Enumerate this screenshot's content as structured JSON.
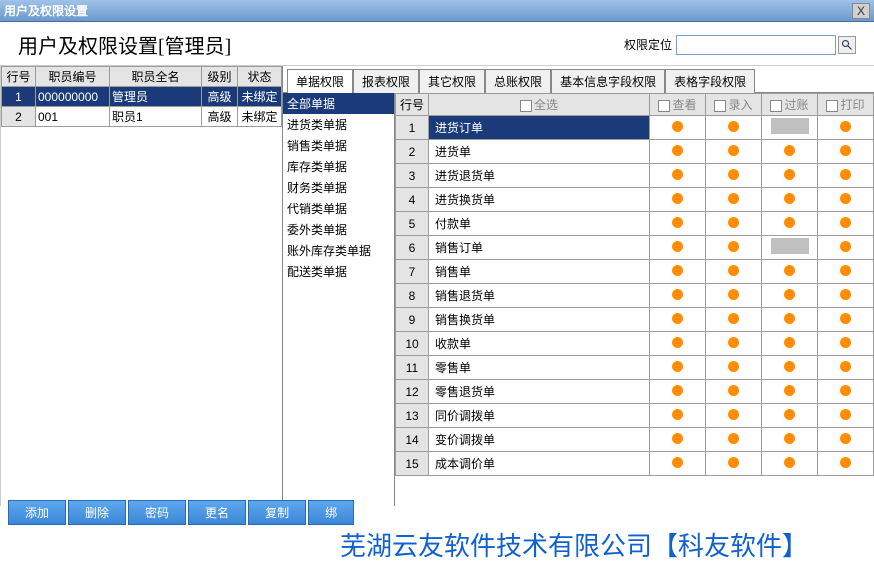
{
  "window": {
    "title": "用户及权限设置",
    "close": "X"
  },
  "header": {
    "title": "用户及权限设置[管理员]",
    "search_label": "权限定位",
    "search_value": ""
  },
  "employee_table": {
    "cols": {
      "row": "行号",
      "id": "职员编号",
      "name": "职员全名",
      "level": "级别",
      "status": "状态"
    },
    "rows": [
      {
        "n": "1",
        "id": "000000000",
        "name": "管理员",
        "level": "高级",
        "status": "未绑定",
        "selected": true
      },
      {
        "n": "2",
        "id": "001",
        "name": "职员1",
        "level": "高级",
        "status": "未绑定",
        "selected": false
      }
    ]
  },
  "tabs": [
    "单据权限",
    "报表权限",
    "其它权限",
    "总账权限",
    "基本信息字段权限",
    "表格字段权限"
  ],
  "active_tab": 0,
  "categories": [
    {
      "label": "全部单据",
      "selected": true
    },
    {
      "label": "进货类单据"
    },
    {
      "label": "销售类单据"
    },
    {
      "label": "库存类单据"
    },
    {
      "label": "财务类单据"
    },
    {
      "label": "代销类单据"
    },
    {
      "label": "委外类单据"
    },
    {
      "label": "账外库存类单据"
    },
    {
      "label": "配送类单据"
    }
  ],
  "perm_cols": {
    "row": "行号",
    "all": "全选",
    "view": "查看",
    "entry": "录入",
    "post": "过账",
    "print": "打印"
  },
  "perm_rows": [
    {
      "n": "1",
      "name": "进货订单",
      "v": "d",
      "e": "d",
      "p": "g",
      "pr": "d",
      "selected": true
    },
    {
      "n": "2",
      "name": "进货单",
      "v": "d",
      "e": "d",
      "p": "d",
      "pr": "d"
    },
    {
      "n": "3",
      "name": "进货退货单",
      "v": "d",
      "e": "d",
      "p": "d",
      "pr": "d"
    },
    {
      "n": "4",
      "name": "进货换货单",
      "v": "d",
      "e": "d",
      "p": "d",
      "pr": "d"
    },
    {
      "n": "5",
      "name": "付款单",
      "v": "d",
      "e": "d",
      "p": "d",
      "pr": "d"
    },
    {
      "n": "6",
      "name": "销售订单",
      "v": "d",
      "e": "d",
      "p": "g",
      "pr": "d"
    },
    {
      "n": "7",
      "name": "销售单",
      "v": "d",
      "e": "d",
      "p": "d",
      "pr": "d"
    },
    {
      "n": "8",
      "name": "销售退货单",
      "v": "d",
      "e": "d",
      "p": "d",
      "pr": "d"
    },
    {
      "n": "9",
      "name": "销售换货单",
      "v": "d",
      "e": "d",
      "p": "d",
      "pr": "d"
    },
    {
      "n": "10",
      "name": "收款单",
      "v": "d",
      "e": "d",
      "p": "d",
      "pr": "d"
    },
    {
      "n": "11",
      "name": "零售单",
      "v": "d",
      "e": "d",
      "p": "d",
      "pr": "d"
    },
    {
      "n": "12",
      "name": "零售退货单",
      "v": "d",
      "e": "d",
      "p": "d",
      "pr": "d"
    },
    {
      "n": "13",
      "name": "同价调拨单",
      "v": "d",
      "e": "d",
      "p": "d",
      "pr": "d"
    },
    {
      "n": "14",
      "name": "变价调拨单",
      "v": "d",
      "e": "d",
      "p": "d",
      "pr": "d"
    },
    {
      "n": "15",
      "name": "成本调价单",
      "v": "d",
      "e": "d",
      "p": "d",
      "pr": "d"
    }
  ],
  "footer_buttons": [
    "添加",
    "删除",
    "密码",
    "更名",
    "复制",
    "绑"
  ],
  "watermark": "芜湖云友软件技术有限公司【科友软件】"
}
